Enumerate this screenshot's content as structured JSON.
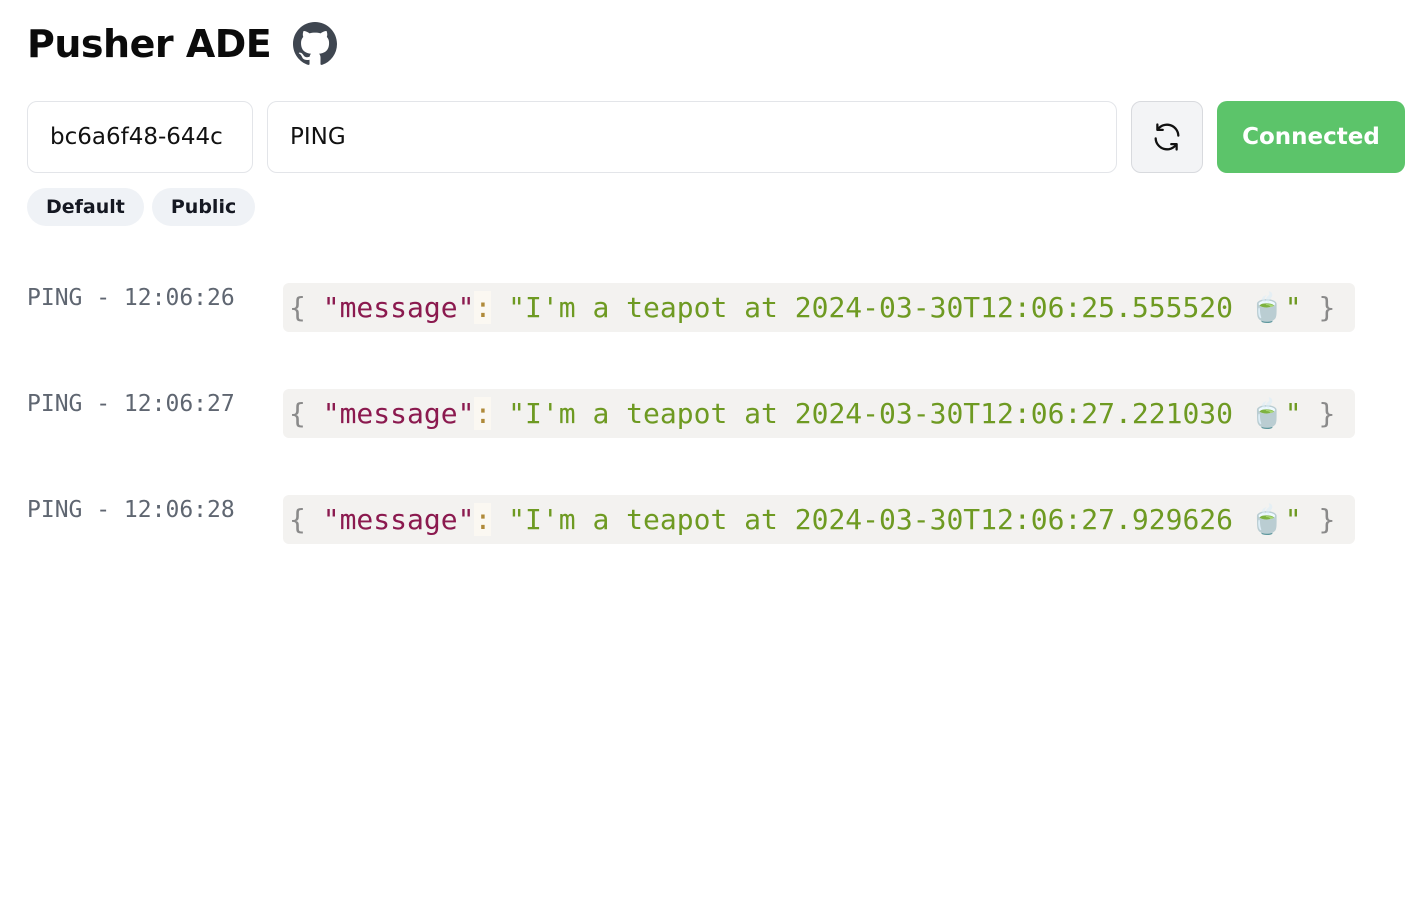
{
  "header": {
    "title": "Pusher ADE",
    "github_icon": "github-icon"
  },
  "controls": {
    "key_input_value": "bc6a6f48-644c",
    "event_input_value": "PING",
    "refresh_icon": "refresh-icon",
    "connect_label": "Connected",
    "connect_color": "#5cc46a"
  },
  "tags": [
    {
      "label": "Default"
    },
    {
      "label": "Public"
    }
  ],
  "events": [
    {
      "label": "PING - 12:06:26",
      "open": "{",
      "key": "\"message\"",
      "colon": ":",
      "value": "\"I'm a teapot at 2024-03-30T12:06:25.555520 🍵\"",
      "close": "}"
    },
    {
      "label": "PING - 12:06:27",
      "open": "{",
      "key": "\"message\"",
      "colon": ":",
      "value": "\"I'm a teapot at 2024-03-30T12:06:27.221030 🍵\"",
      "close": "}"
    },
    {
      "label": "PING - 12:06:28",
      "open": "{",
      "key": "\"message\"",
      "colon": ":",
      "value": "\"I'm a teapot at 2024-03-30T12:06:27.929626 🍵\"",
      "close": "}"
    }
  ]
}
